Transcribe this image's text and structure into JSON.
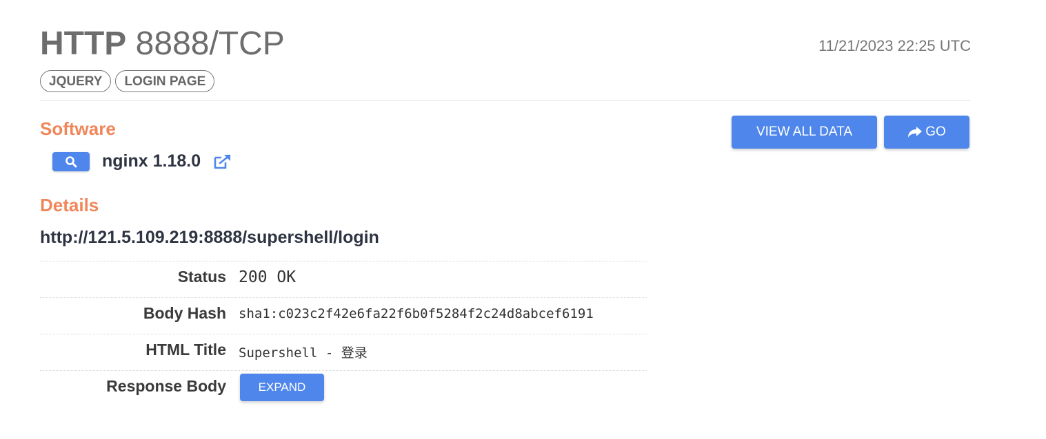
{
  "header": {
    "protocol": "HTTP",
    "port": "8888/TCP",
    "timestamp": "11/21/2023 22:25 UTC"
  },
  "tags": [
    "JQUERY",
    "LOGIN PAGE"
  ],
  "software": {
    "heading": "Software",
    "name": "nginx 1.18.0",
    "search_icon": "search-icon",
    "link_icon": "external-link-icon"
  },
  "actions": {
    "view_all_label": "VIEW ALL DATA",
    "go_label": "GO",
    "go_icon": "share-arrow-icon"
  },
  "details": {
    "heading": "Details",
    "url": "http://121.5.109.219:8888/supershell/login",
    "rows": [
      {
        "label": "Status",
        "value": "200 OK"
      },
      {
        "label": "Body Hash",
        "value": "sha1:c023c2f42e6fa22f6b0f5284f2c24d8abcef6191"
      },
      {
        "label": "HTML Title",
        "value": "Supershell - 登录"
      },
      {
        "label": "Response Body",
        "button": "EXPAND"
      }
    ]
  },
  "colors": {
    "accent": "#4f86ec",
    "heading": "#f0875a",
    "title": "#6d6d6d"
  }
}
